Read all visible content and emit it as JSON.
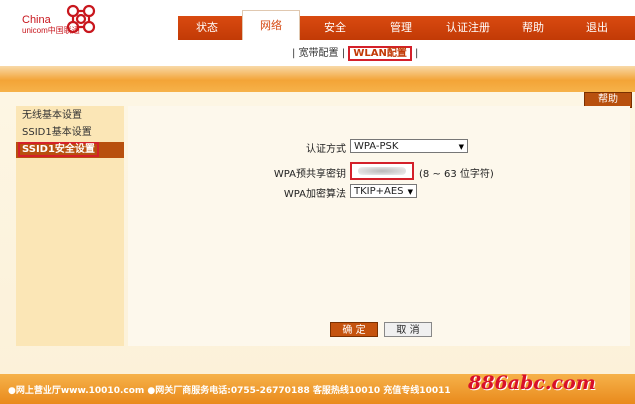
{
  "brand": {
    "china": "China",
    "unicom": "unicom中国联通"
  },
  "nav": {
    "items": [
      {
        "label": "状态"
      },
      {
        "label": "网络"
      },
      {
        "label": "安全"
      },
      {
        "label": "管理"
      },
      {
        "label": "认证注册"
      },
      {
        "label": "帮助"
      },
      {
        "label": "退出"
      }
    ],
    "active": "网络"
  },
  "subnav": {
    "sep": "|",
    "items": [
      {
        "label": "宽带配置"
      },
      {
        "label": "WLAN配置"
      }
    ],
    "active": "WLAN配置"
  },
  "help_label": "帮助",
  "sidebar": {
    "items": [
      {
        "label": "无线基本设置"
      },
      {
        "label": "SSID1基本设置"
      },
      {
        "label": "SSID1安全设置"
      }
    ],
    "active": "SSID1安全设置"
  },
  "form": {
    "auth_label": "认证方式",
    "auth_value": "WPA-PSK",
    "psk_label": "WPA预共享密钥",
    "psk_hint": "(8 ~ 63 位字符)",
    "algo_label": "WPA加密算法",
    "algo_value": "TKIP+AES",
    "dropdown_arrow": "▼"
  },
  "buttons": {
    "ok": "确 定",
    "cancel": "取 消"
  },
  "footer": {
    "text": "●网上营业厅www.10010.com  ●网关厂商服务电话:0755-26770188  客服热线10010  充值专线10011"
  },
  "watermark": "886abc.com",
  "colors": {
    "accent": "#c23a06",
    "highlight": "#d4202a",
    "band": "#f3a437"
  }
}
